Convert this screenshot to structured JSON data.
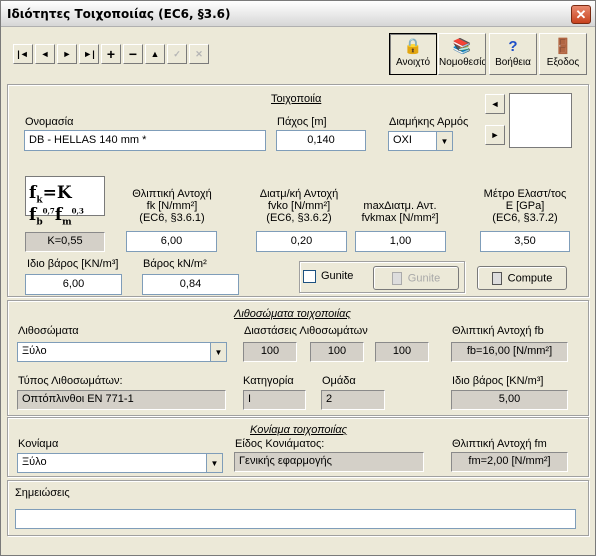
{
  "window": {
    "title": "Ιδιότητες Τοιχοποιίας (EC6, §3.6)",
    "close": "✕"
  },
  "toolbar": {
    "nav": {
      "first": "|◄",
      "prev": "◄",
      "next": "►",
      "last": "►|",
      "add": "+",
      "remove": "−",
      "up": "▲",
      "confirm": "✓",
      "cancel": "✕"
    },
    "buttons": [
      {
        "label": "Ανοιχτό",
        "icon": "lock-icon",
        "glyph": "🔒"
      },
      {
        "label": "Νομοθεσία",
        "icon": "books-icon",
        "glyph": "📚"
      },
      {
        "label": "Βοήθεια",
        "icon": "help-icon",
        "glyph": "?"
      },
      {
        "label": "Εξοδος",
        "icon": "exit-icon",
        "glyph": "🚪"
      }
    ]
  },
  "wall": {
    "section_title": "Τοιχοποιία",
    "name_label": "Ονομασία",
    "name_value": "DB - HELLAS 140 mm *",
    "thickness_label": "Πάχος [m]",
    "thickness_value": "0,140",
    "joint_label": "Διαμήκης Αρμός",
    "joint_value": "ΟΧΙ",
    "formula": {
      "f": "f",
      "k": "k",
      "eq": "=K",
      "b": "b",
      "bexp": "0,7",
      "m": "m",
      "mexp": "0,3"
    },
    "k_value": "K=0,55",
    "fk_label_1": "Θλιπτική Αντοχή",
    "fk_label_2": "fk [N/mm²]",
    "fk_label_3": "(EC6, §3.6.1)",
    "fk_value": "6,00",
    "fvko_label_1": "Διατμ/κή Αντοχή",
    "fvko_label_2": "fvko [N/mm²]",
    "fvko_label_3": "(EC6, §3.6.2)",
    "fvko_value": "0,20",
    "fvkmax_label_1": "maxΔιατμ. Αντ.",
    "fvkmax_label_2": "fvkmax [N/mm²]",
    "fvkmax_value": "1,00",
    "e_label_1": "Μέτρο Ελαστ/τος",
    "e_label_2": "E [GPa]",
    "e_label_3": "(EC6, §3.7.2)",
    "e_value": "3,50",
    "unit_weight_label": "Ιδιο βάρος [KN/m³]",
    "unit_weight_value": "6,00",
    "weight_label": "Βάρος kN/m²",
    "weight_value": "0,84",
    "gunite_check_label": "Gunite",
    "gunite_button_label": "Gunite",
    "compute_label": "Compute"
  },
  "units": {
    "section_title": "Λιθοσώματα τοιχοποιίας",
    "units_label": "Λιθοσώματα",
    "units_value": "Ξύλο",
    "dims_label": "Διαστάσεις Λιθοσωμάτων",
    "dims": [
      "100",
      "100",
      "100"
    ],
    "fb_label": "Θλιπτική Αντοχή fb",
    "fb_value": "fb=16,00  [N/mm²]",
    "type_label": "Τύπος Λιθοσωμάτων:",
    "type_value": "Οπτόπλινθοι EN 771-1",
    "category_label": "Κατηγορία",
    "category_value": "I",
    "group_label": "Ομάδα",
    "group_value": "2",
    "weight_label": "Ιδιο βάρος [KN/m³]",
    "weight_value": "5,00"
  },
  "mortar": {
    "section_title": "Κονίαμα τοιχοποιίας",
    "mortar_label": "Κονίαμα",
    "mortar_value": "Ξύλο",
    "kind_label": "Είδος Κονιάματος:",
    "kind_value": "Γενικής εφαρμογής",
    "fm_label": "Θλιπτική Αντοχή fm",
    "fm_value": "fm=2,00  [N/mm²]"
  },
  "notes": {
    "label": "Σημειώσεις",
    "value": ""
  }
}
